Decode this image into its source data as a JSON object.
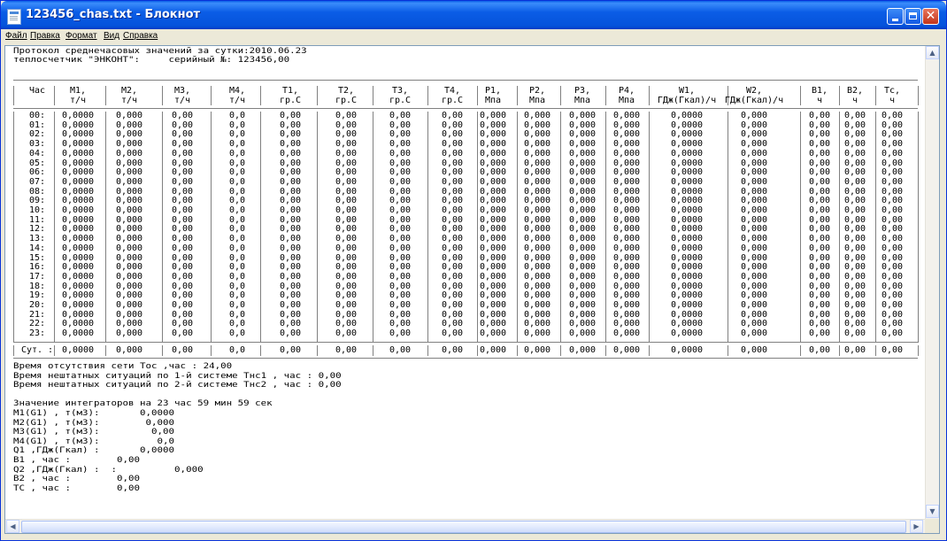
{
  "window": {
    "title": "123456_chas.txt - Блокнот"
  },
  "menu": [
    {
      "label": "Файл"
    },
    {
      "label": "Правка"
    },
    {
      "label": "Формат"
    },
    {
      "label": "Вид"
    },
    {
      "label": "Справка"
    }
  ],
  "doc": {
    "header_lines": [
      "Протокол среднечасовых значений за сутки:2010.06.23",
      "теплосчетчик \"ЭНКОНТ\":     серийный №: 123456,00"
    ],
    "columns": [
      {
        "top": "Час",
        "unit": ""
      },
      {
        "top": "M1,",
        "unit": "т/ч"
      },
      {
        "top": "M2,",
        "unit": "т/ч"
      },
      {
        "top": "M3,",
        "unit": "т/ч"
      },
      {
        "top": "M4,",
        "unit": "т/ч"
      },
      {
        "top": "T1,",
        "unit": "гр.С"
      },
      {
        "top": "T2,",
        "unit": "гр.С"
      },
      {
        "top": "T3,",
        "unit": "гр.С"
      },
      {
        "top": "T4,",
        "unit": "гр.С"
      },
      {
        "top": "P1,",
        "unit": "Мпа"
      },
      {
        "top": "P2,",
        "unit": "Мпа"
      },
      {
        "top": "P3,",
        "unit": "Мпа"
      },
      {
        "top": "P4,",
        "unit": "Мпа"
      },
      {
        "top": "W1,",
        "unit": "ГДж(Гкал)/ч"
      },
      {
        "top": "W2,",
        "unit": "ГДж(Гкал)/ч"
      },
      {
        "top": "B1,",
        "unit": "ч"
      },
      {
        "top": "B2,",
        "unit": "ч"
      },
      {
        "top": "Tc,",
        "unit": "ч"
      }
    ],
    "rows": [
      [
        "00:",
        "0,0000",
        "0,000",
        "0,00",
        "0,0",
        "0,00",
        "0,00",
        "0,00",
        "0,00",
        "0,000",
        "0,000",
        "0,000",
        "0,000",
        "0,0000",
        "0,000",
        "0,00",
        "0,00",
        "0,00"
      ],
      [
        "01:",
        "0,0000",
        "0,000",
        "0,00",
        "0,0",
        "0,00",
        "0,00",
        "0,00",
        "0,00",
        "0,000",
        "0,000",
        "0,000",
        "0,000",
        "0,0000",
        "0,000",
        "0,00",
        "0,00",
        "0,00"
      ],
      [
        "02:",
        "0,0000",
        "0,000",
        "0,00",
        "0,0",
        "0,00",
        "0,00",
        "0,00",
        "0,00",
        "0,000",
        "0,000",
        "0,000",
        "0,000",
        "0,0000",
        "0,000",
        "0,00",
        "0,00",
        "0,00"
      ],
      [
        "03:",
        "0,0000",
        "0,000",
        "0,00",
        "0,0",
        "0,00",
        "0,00",
        "0,00",
        "0,00",
        "0,000",
        "0,000",
        "0,000",
        "0,000",
        "0,0000",
        "0,000",
        "0,00",
        "0,00",
        "0,00"
      ],
      [
        "04:",
        "0,0000",
        "0,000",
        "0,00",
        "0,0",
        "0,00",
        "0,00",
        "0,00",
        "0,00",
        "0,000",
        "0,000",
        "0,000",
        "0,000",
        "0,0000",
        "0,000",
        "0,00",
        "0,00",
        "0,00"
      ],
      [
        "05:",
        "0,0000",
        "0,000",
        "0,00",
        "0,0",
        "0,00",
        "0,00",
        "0,00",
        "0,00",
        "0,000",
        "0,000",
        "0,000",
        "0,000",
        "0,0000",
        "0,000",
        "0,00",
        "0,00",
        "0,00"
      ],
      [
        "06:",
        "0,0000",
        "0,000",
        "0,00",
        "0,0",
        "0,00",
        "0,00",
        "0,00",
        "0,00",
        "0,000",
        "0,000",
        "0,000",
        "0,000",
        "0,0000",
        "0,000",
        "0,00",
        "0,00",
        "0,00"
      ],
      [
        "07:",
        "0,0000",
        "0,000",
        "0,00",
        "0,0",
        "0,00",
        "0,00",
        "0,00",
        "0,00",
        "0,000",
        "0,000",
        "0,000",
        "0,000",
        "0,0000",
        "0,000",
        "0,00",
        "0,00",
        "0,00"
      ],
      [
        "08:",
        "0,0000",
        "0,000",
        "0,00",
        "0,0",
        "0,00",
        "0,00",
        "0,00",
        "0,00",
        "0,000",
        "0,000",
        "0,000",
        "0,000",
        "0,0000",
        "0,000",
        "0,00",
        "0,00",
        "0,00"
      ],
      [
        "09:",
        "0,0000",
        "0,000",
        "0,00",
        "0,0",
        "0,00",
        "0,00",
        "0,00",
        "0,00",
        "0,000",
        "0,000",
        "0,000",
        "0,000",
        "0,0000",
        "0,000",
        "0,00",
        "0,00",
        "0,00"
      ],
      [
        "10:",
        "0,0000",
        "0,000",
        "0,00",
        "0,0",
        "0,00",
        "0,00",
        "0,00",
        "0,00",
        "0,000",
        "0,000",
        "0,000",
        "0,000",
        "0,0000",
        "0,000",
        "0,00",
        "0,00",
        "0,00"
      ],
      [
        "11:",
        "0,0000",
        "0,000",
        "0,00",
        "0,0",
        "0,00",
        "0,00",
        "0,00",
        "0,00",
        "0,000",
        "0,000",
        "0,000",
        "0,000",
        "0,0000",
        "0,000",
        "0,00",
        "0,00",
        "0,00"
      ],
      [
        "12:",
        "0,0000",
        "0,000",
        "0,00",
        "0,0",
        "0,00",
        "0,00",
        "0,00",
        "0,00",
        "0,000",
        "0,000",
        "0,000",
        "0,000",
        "0,0000",
        "0,000",
        "0,00",
        "0,00",
        "0,00"
      ],
      [
        "13:",
        "0,0000",
        "0,000",
        "0,00",
        "0,0",
        "0,00",
        "0,00",
        "0,00",
        "0,00",
        "0,000",
        "0,000",
        "0,000",
        "0,000",
        "0,0000",
        "0,000",
        "0,00",
        "0,00",
        "0,00"
      ],
      [
        "14:",
        "0,0000",
        "0,000",
        "0,00",
        "0,0",
        "0,00",
        "0,00",
        "0,00",
        "0,00",
        "0,000",
        "0,000",
        "0,000",
        "0,000",
        "0,0000",
        "0,000",
        "0,00",
        "0,00",
        "0,00"
      ],
      [
        "15:",
        "0,0000",
        "0,000",
        "0,00",
        "0,0",
        "0,00",
        "0,00",
        "0,00",
        "0,00",
        "0,000",
        "0,000",
        "0,000",
        "0,000",
        "0,0000",
        "0,000",
        "0,00",
        "0,00",
        "0,00"
      ],
      [
        "16:",
        "0,0000",
        "0,000",
        "0,00",
        "0,0",
        "0,00",
        "0,00",
        "0,00",
        "0,00",
        "0,000",
        "0,000",
        "0,000",
        "0,000",
        "0,0000",
        "0,000",
        "0,00",
        "0,00",
        "0,00"
      ],
      [
        "17:",
        "0,0000",
        "0,000",
        "0,00",
        "0,0",
        "0,00",
        "0,00",
        "0,00",
        "0,00",
        "0,000",
        "0,000",
        "0,000",
        "0,000",
        "0,0000",
        "0,000",
        "0,00",
        "0,00",
        "0,00"
      ],
      [
        "18:",
        "0,0000",
        "0,000",
        "0,00",
        "0,0",
        "0,00",
        "0,00",
        "0,00",
        "0,00",
        "0,000",
        "0,000",
        "0,000",
        "0,000",
        "0,0000",
        "0,000",
        "0,00",
        "0,00",
        "0,00"
      ],
      [
        "19:",
        "0,0000",
        "0,000",
        "0,00",
        "0,0",
        "0,00",
        "0,00",
        "0,00",
        "0,00",
        "0,000",
        "0,000",
        "0,000",
        "0,000",
        "0,0000",
        "0,000",
        "0,00",
        "0,00",
        "0,00"
      ],
      [
        "20:",
        "0,0000",
        "0,000",
        "0,00",
        "0,0",
        "0,00",
        "0,00",
        "0,00",
        "0,00",
        "0,000",
        "0,000",
        "0,000",
        "0,000",
        "0,0000",
        "0,000",
        "0,00",
        "0,00",
        "0,00"
      ],
      [
        "21:",
        "0,0000",
        "0,000",
        "0,00",
        "0,0",
        "0,00",
        "0,00",
        "0,00",
        "0,00",
        "0,000",
        "0,000",
        "0,000",
        "0,000",
        "0,0000",
        "0,000",
        "0,00",
        "0,00",
        "0,00"
      ],
      [
        "22:",
        "0,0000",
        "0,000",
        "0,00",
        "0,0",
        "0,00",
        "0,00",
        "0,00",
        "0,00",
        "0,000",
        "0,000",
        "0,000",
        "0,000",
        "0,0000",
        "0,000",
        "0,00",
        "0,00",
        "0,00"
      ],
      [
        "23:",
        "0,0000",
        "0,000",
        "0,00",
        "0,0",
        "0,00",
        "0,00",
        "0,00",
        "0,00",
        "0,000",
        "0,000",
        "0,000",
        "0,000",
        "0,0000",
        "0,000",
        "0,00",
        "0,00",
        "0,00"
      ]
    ],
    "summary_row": [
      "Сут. :",
      "0,0000",
      "0,000",
      "0,00",
      "0,0",
      "0,00",
      "0,00",
      "0,00",
      "0,00",
      "0,000",
      "0,000",
      "0,000",
      "0,000",
      "0,0000",
      "0,000",
      "0,00",
      "0,00",
      "0,00"
    ],
    "footer_lines": [
      "Время отсутствия сети Тос ,час : 24,00",
      "Время нештатных ситуаций по 1-й системе Тнс1 , час : 0,00",
      "Время нештатных ситуаций по 2-й системе Тнс2 , час : 0,00",
      "",
      "Значение интеграторов на 23 час 59 мин 59 сек",
      "M1(G1) , т(м3):       0,0000",
      "M2(G1) , т(м3):        0,000",
      "M3(G1) , т(м3):         0,00",
      "M4(G1) , т(м3):          0,0",
      "Q1 ,ГДж(Гкал) :       0,0000",
      "B1 , час :        0,00",
      "Q2 ,ГДж(Гкал) :  :          0,000",
      "B2 , час :        0,00",
      "TC , час :        0,00"
    ]
  }
}
